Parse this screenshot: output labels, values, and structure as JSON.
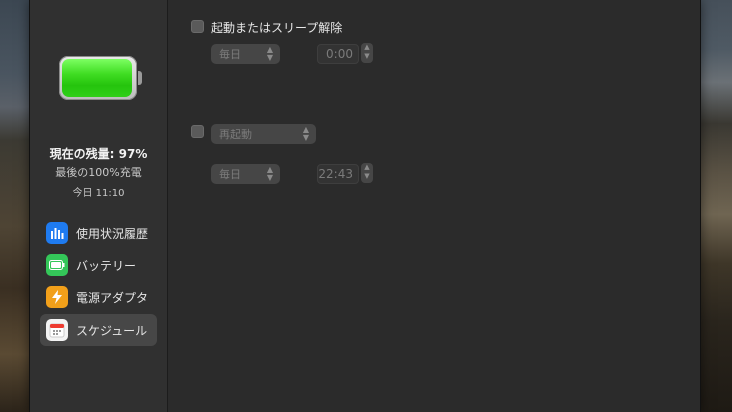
{
  "sidebar": {
    "battery": {
      "level_fraction": 0.97,
      "color": "#34c759"
    },
    "status": {
      "level_text": "現在の残量: 97%",
      "last_charged": "最後の100%充電",
      "time": "今日 11:10"
    },
    "items": [
      {
        "label": "使用状況履歴",
        "icon": "bar-chart-icon",
        "color": "#1f7bf0",
        "selected": false
      },
      {
        "label": "バッテリー",
        "icon": "battery-icon",
        "color": "#34c759",
        "selected": false
      },
      {
        "label": "電源アダプタ",
        "icon": "lightning-icon",
        "color": "#f2a01a",
        "selected": false
      },
      {
        "label": "スケジュール",
        "icon": "calendar-icon",
        "color": "#f4f4f4",
        "selected": true
      }
    ]
  },
  "schedule": {
    "wake": {
      "checkbox_label": "起動またはスリープ解除",
      "checked": false,
      "frequency": "毎日",
      "time": "0:00"
    },
    "second": {
      "checked": false,
      "action": "再起動",
      "frequency": "毎日",
      "time": "22:43"
    }
  }
}
